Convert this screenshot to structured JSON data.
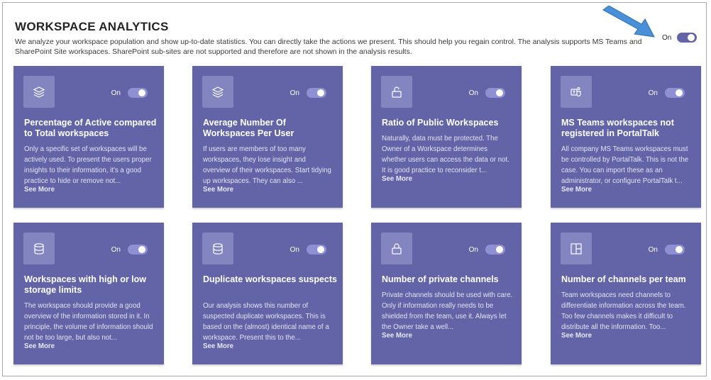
{
  "header": {
    "title": "WORKSPACE ANALYTICS",
    "description": "We analyze your workspace population and show up-to-date statistics. You can directly take the actions we present. This should help you regain control. The analysis supports MS Teams and SharePoint Site workspaces. SharePoint sub-sites are not supported and therefore are not shown in the analysis results.",
    "toggle_label": "On",
    "toggle_state": "on"
  },
  "colors": {
    "card_bg": "#6264a7",
    "icon_bg": "#8385c0",
    "toggle_on": "#6264a7",
    "arrow": "#4a90d9"
  },
  "cards": [
    {
      "icon": "layers-icon",
      "title": "Percentage of Active compared to Total workspaces",
      "description": "Only a specific set of workspaces will be actively used. To present the users proper insights to their information, it's a good practice to hide or remove not...",
      "see_more": "See More",
      "toggle_label": "On"
    },
    {
      "icon": "layers-icon",
      "title": "Average Number Of Workspaces Per User",
      "description": "If users are members of too many workspaces, they lose insight and overview of their workspaces. Start tidying up workspaces. They can also ...",
      "see_more": "See More",
      "toggle_label": "On"
    },
    {
      "icon": "unlock-icon",
      "title": "Ratio of Public Workspaces",
      "description": "Naturally, data must be protected. The Owner of a Workspace determines whether users can access the data or not. It is good practice to reconsider t...",
      "see_more": "See More",
      "toggle_label": "On"
    },
    {
      "icon": "teams-icon",
      "title": "MS Teams workspaces not registered in PortalTalk",
      "description": "All company MS Teams workspaces must be controlled by PortalTalk. This is not the case. You can import these as an administrator, or configure PortalTalk t...",
      "see_more": "See More",
      "toggle_label": "On"
    },
    {
      "icon": "database-icon",
      "title": "Workspaces with high or low storage limits",
      "description": "The workspace should provide a good overview of the information stored in it. In principle, the volume of information should not be too large, but also not...",
      "see_more": "See More",
      "toggle_label": "On"
    },
    {
      "icon": "database-icon",
      "title": "Duplicate workspaces suspects",
      "description": "Our analysis shows this number of suspected duplicate workspaces. This is based on the (almost) identical name of a workspace. Present this to the...",
      "see_more": "See More",
      "toggle_label": "On"
    },
    {
      "icon": "lock-icon",
      "title": "Number of private channels",
      "description": "Private channels should be used with care. Only if information really needs to be shielded from the team, use it. Always let the Owner take a well...",
      "see_more": "See More",
      "toggle_label": "On"
    },
    {
      "icon": "board-icon",
      "title": "Number of channels per team",
      "description": "Team workspaces need channels to differentiate information across the team. Too few channels makes it difficult to distribute all the information. Too...",
      "see_more": "See More",
      "toggle_label": "On"
    }
  ]
}
